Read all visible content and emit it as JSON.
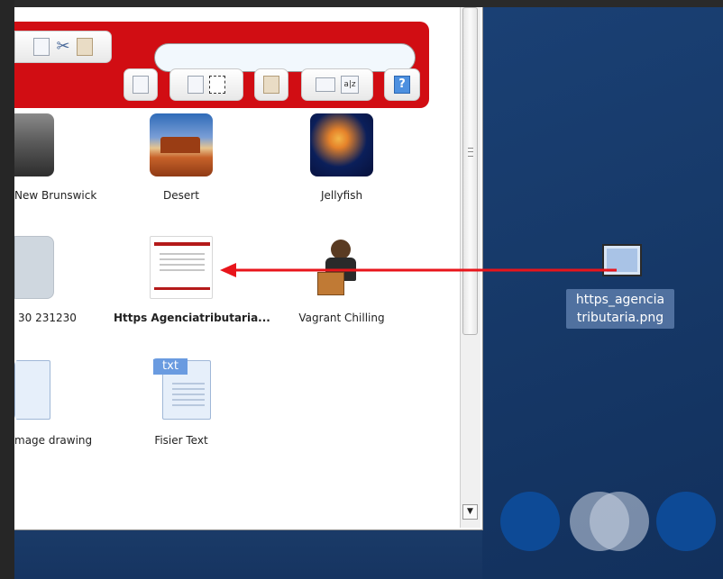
{
  "search": {
    "placeholder": ""
  },
  "toolbar": {
    "help_label": "?",
    "sort_label": "a|z"
  },
  "files": [
    {
      "name": "New Brunswick"
    },
    {
      "name": "Desert"
    },
    {
      "name": "Jellyfish"
    },
    {
      "name": "30 231230"
    },
    {
      "name": "Https Agenciatributaria..."
    },
    {
      "name": "Vagrant Chilling"
    },
    {
      "name": "mage drawing"
    },
    {
      "name": "Fisier Text",
      "tag": "txt"
    }
  ],
  "desktop": {
    "file_name": "https_agencia tributaria.png"
  },
  "colors": {
    "toolbar": "#d10d13",
    "desktop_bg": "#173a6a",
    "arrow": "#e8151b"
  }
}
